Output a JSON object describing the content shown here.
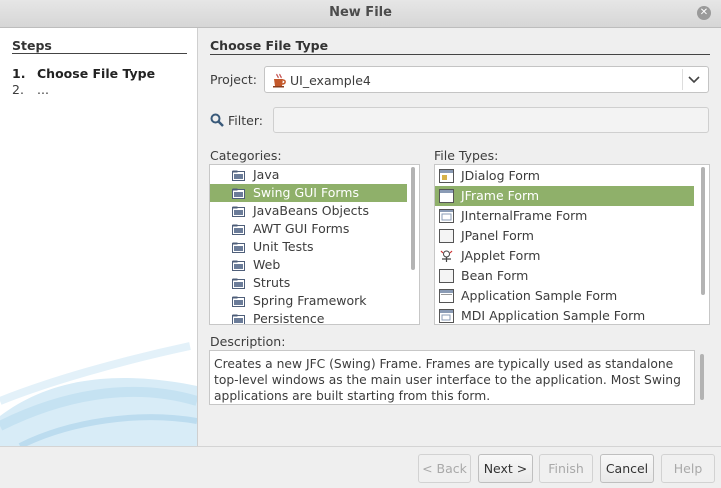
{
  "window": {
    "title": "New File"
  },
  "steps": {
    "heading": "Steps",
    "items": [
      {
        "num": "1.",
        "label": "Choose File Type"
      },
      {
        "num": "2.",
        "label": "..."
      }
    ]
  },
  "main": {
    "heading": "Choose File Type",
    "project_label": "Project:",
    "project_value": "UI_example4",
    "filter_label": "Filter:",
    "filter_value": "",
    "categories_label": "Categories:",
    "categories": [
      "Java",
      "Swing GUI Forms",
      "JavaBeans Objects",
      "AWT GUI Forms",
      "Unit Tests",
      "Web",
      "Struts",
      "Spring Framework",
      "Persistence"
    ],
    "selected_category": "Swing GUI Forms",
    "file_types_label": "File Types:",
    "file_types": [
      "JDialog Form",
      "JFrame Form",
      "JInternalFrame Form",
      "JPanel Form",
      "JApplet Form",
      "Bean Form",
      "Application Sample Form",
      "MDI Application Sample Form"
    ],
    "selected_file_type": "JFrame Form",
    "description_label": "Description:",
    "description_text": "Creates a new JFC (Swing) Frame. Frames are typically used as standalone top-level windows as the main user interface to the application. Most Swing applications are built starting from this form."
  },
  "buttons": {
    "back": "< Back",
    "next": "Next >",
    "finish": "Finish",
    "cancel": "Cancel",
    "help": "Help"
  },
  "colors": {
    "selection": "#8fb06a",
    "folder": "#4f5f7a"
  }
}
